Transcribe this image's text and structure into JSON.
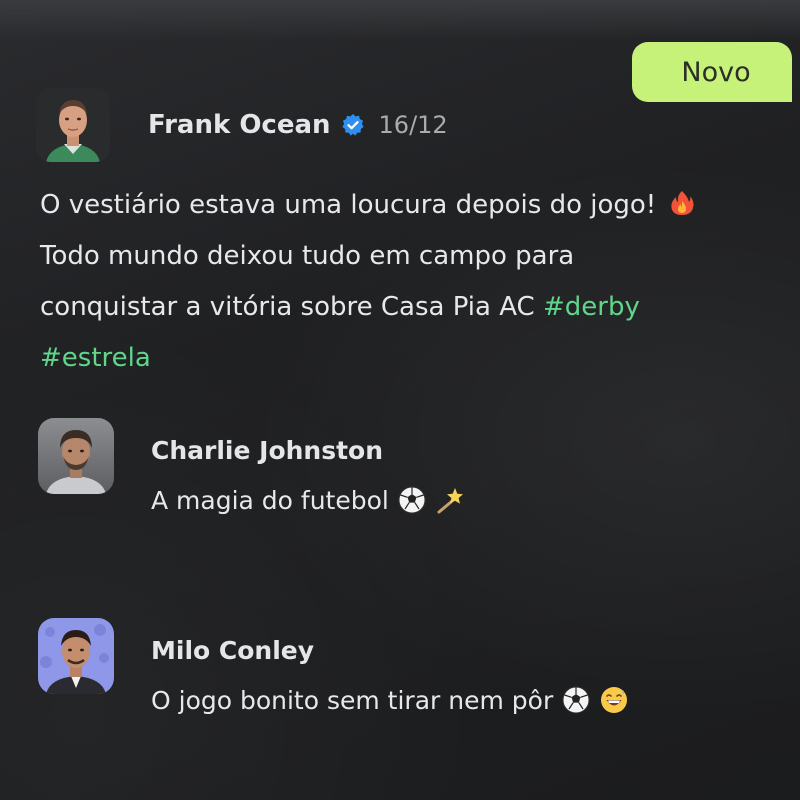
{
  "badge": {
    "label": "Novo"
  },
  "post": {
    "author": "Frank Ocean",
    "date": "16/12",
    "text_line1": "O vestiário estava uma loucura depois do jogo!",
    "text_line2": "Todo mundo deixou tudo em campo para",
    "text_line3": "conquistar a vitória sobre Casa Pia AC",
    "hashtags": [
      "#derby",
      "#estrela"
    ],
    "icons": {
      "verified": "verified-check-icon",
      "emoji": "fire-emoji-icon"
    }
  },
  "comments": [
    {
      "author": "Charlie Johnston",
      "text": "A magia do futebol",
      "emojis": [
        "soccer-ball-emoji-icon",
        "shooting-star-emoji-icon"
      ]
    },
    {
      "author": "Milo Conley",
      "text": "O jogo bonito sem tirar nem pôr",
      "emojis": [
        "soccer-ball-emoji-icon",
        "grinning-sweat-emoji-icon"
      ]
    }
  ],
  "colors": {
    "background": "#1f2022",
    "badge": "#c7f279",
    "hashtag": "#5fd68a",
    "verified": "#2f8ff0"
  }
}
